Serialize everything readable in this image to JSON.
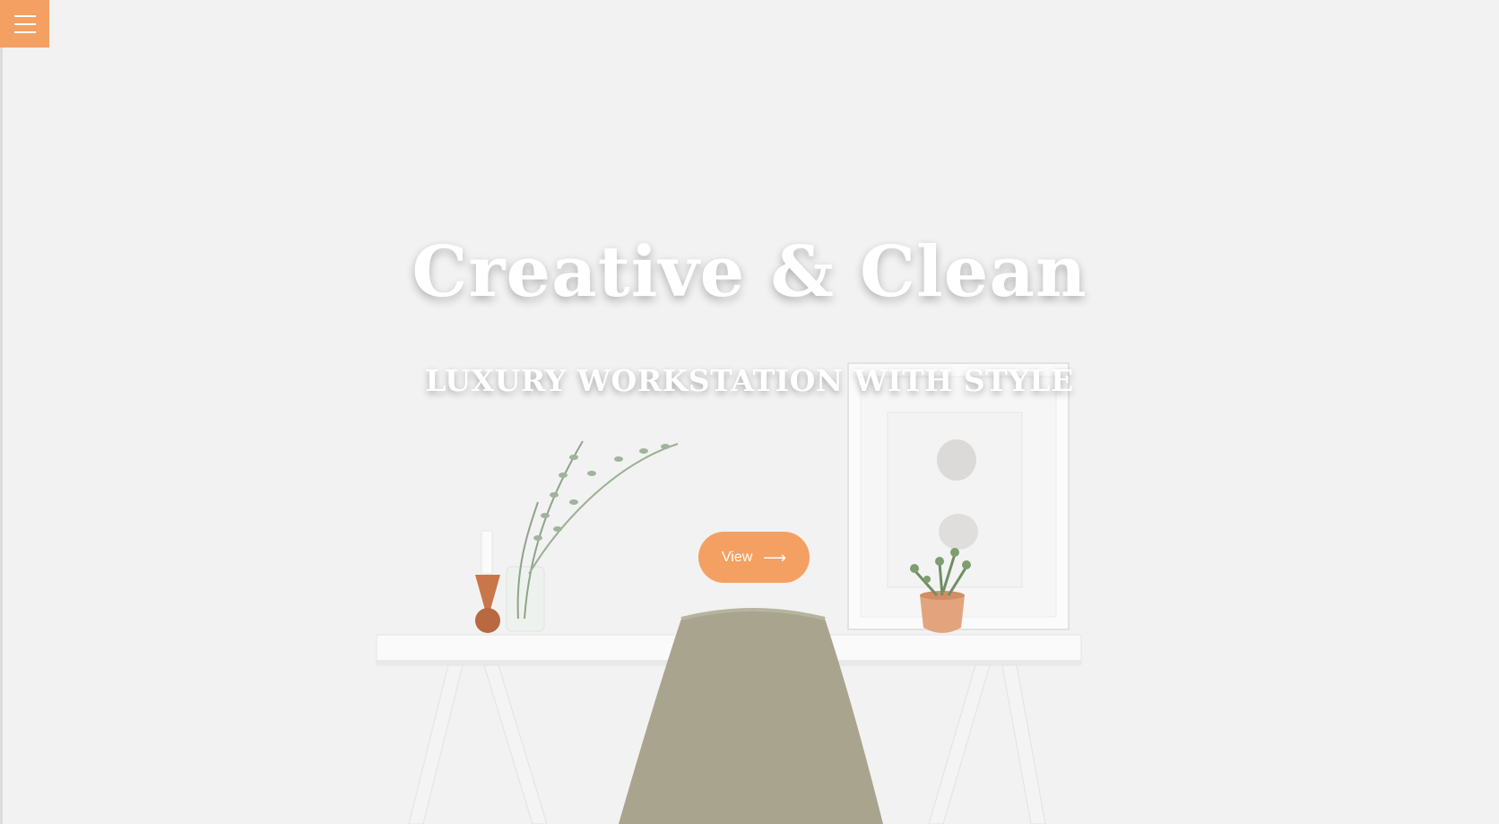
{
  "colors": {
    "accent": "#f4a062",
    "background": "#efefef"
  },
  "hero": {
    "title": "Creative & Clean",
    "subtitle": "LUXURY WORKSTATION WITH STYLE",
    "cta_label": "View",
    "cta_icon": "arrow-right-icon",
    "menu_icon": "hamburger-menu-icon"
  }
}
